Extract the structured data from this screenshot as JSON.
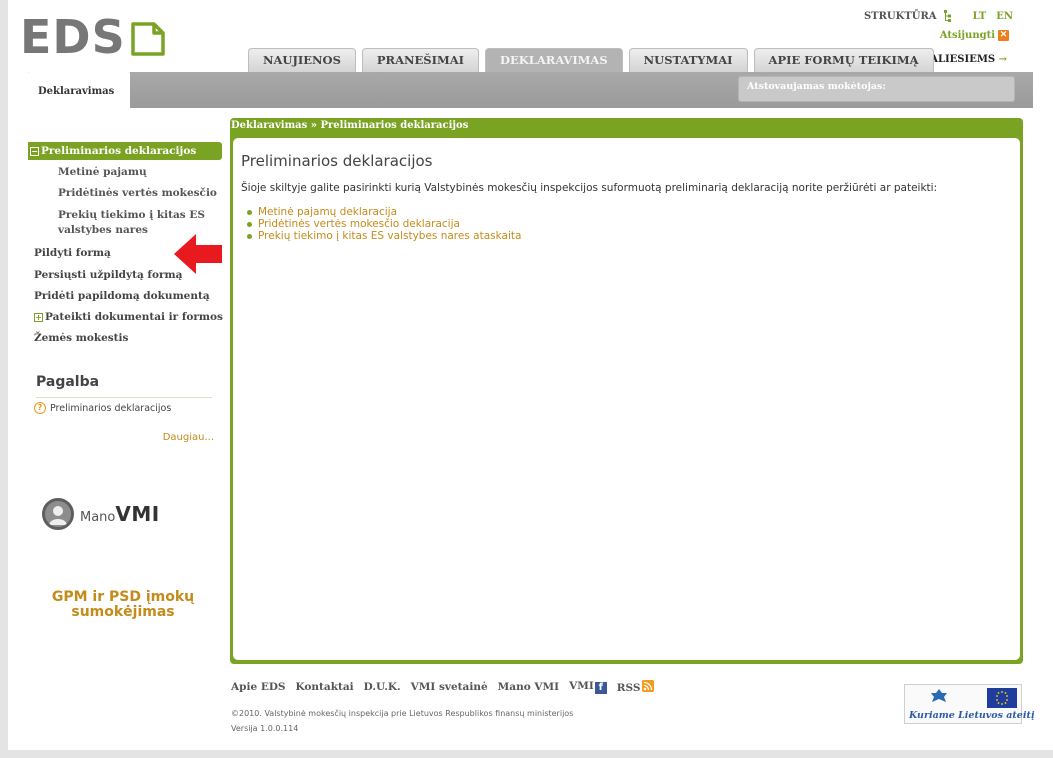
{
  "header": {
    "logo_text": "EDS",
    "struct_label": "STRUKTŪRA",
    "lang_lt": "LT",
    "lang_en": "EN",
    "logout_label": "Atsijungti",
    "disabled_label": "NEĮGALIESIEMS",
    "disabled_arrow": "→",
    "tabs": [
      {
        "label": "NAUJIENOS",
        "active": false
      },
      {
        "label": "PRANEŠIMAI",
        "active": false
      },
      {
        "label": "DEKLARAVIMAS",
        "active": true
      },
      {
        "label": "NUSTATYMAI",
        "active": false
      },
      {
        "label": "APIE FORMŲ TEIKIMĄ",
        "active": false
      }
    ],
    "subtab_label": "Deklaravimas",
    "taxpayer_label": "Atstovaujamas mokėtojas:"
  },
  "sidebar": {
    "active_item": "Preliminarios deklaracijos",
    "items": [
      {
        "label": "Metinė pajamų"
      },
      {
        "label": "Pridėtinės vertės mokesčio"
      },
      {
        "label": "Prekių tiekimo į kitas ES"
      },
      {
        "label": "valstybes nares"
      },
      {
        "label": "Pildyti formą"
      },
      {
        "label": "Persiųsti užpildytą formą"
      },
      {
        "label": "Pridėti papildomą dokumentą"
      },
      {
        "label": "Pateikti dokumentai ir formos"
      },
      {
        "label": "Žemės mokestis"
      }
    ],
    "collapse_symbol": "−",
    "expand_symbol": "+"
  },
  "help": {
    "title": "Pagalba",
    "item": "Preliminarios deklaracijos",
    "more": "Daugiau...",
    "q_symbol": "?"
  },
  "mano": {
    "prefix": "Mano",
    "suffix": "VMI"
  },
  "gpm": {
    "line1": "GPM ir PSD įmokų",
    "line2": "sumokėjimas"
  },
  "main": {
    "breadcrumb": "Deklaravimas » Preliminarios deklaracijos",
    "title": "Preliminarios deklaracijos",
    "description": "Šioje skiltyje galite pasirinkti kurią Valstybinės mokesčių inspekcijos suformuotą preliminarią deklaraciją norite peržiūrėti ar pateikti:",
    "links": [
      "Metinė pajamų deklaracija",
      "Pridėtinės vertės mokesčio deklaracija",
      "Prekių tiekimo į kitas ES valstybes nares ataskaita"
    ]
  },
  "footer": {
    "links": [
      "Apie EDS",
      "Kontaktai",
      "D.U.K.",
      "VMI svetainė",
      "Mano VMI",
      "VMI",
      "RSS"
    ],
    "fb_symbol": "f",
    "copyright": "©2010. Valstybinė mokesčių inspekcija prie Lietuvos Respublikos finansų ministerijos",
    "version": "Versija 1.0.0.114",
    "eu_slogan": "Kuriame Lietuvos ateitį"
  },
  "colors": {
    "accent_green": "#7aa324",
    "link_gold": "#c48b1a",
    "tab_gray": "#b3b3b3",
    "arrow_red": "#e8191f"
  },
  "icons": [
    "document-icon",
    "structure-icon",
    "close-icon",
    "red-arrow-icon",
    "help-icon",
    "avatar-icon",
    "facebook-icon",
    "rss-icon",
    "eu-flag-icon"
  ]
}
